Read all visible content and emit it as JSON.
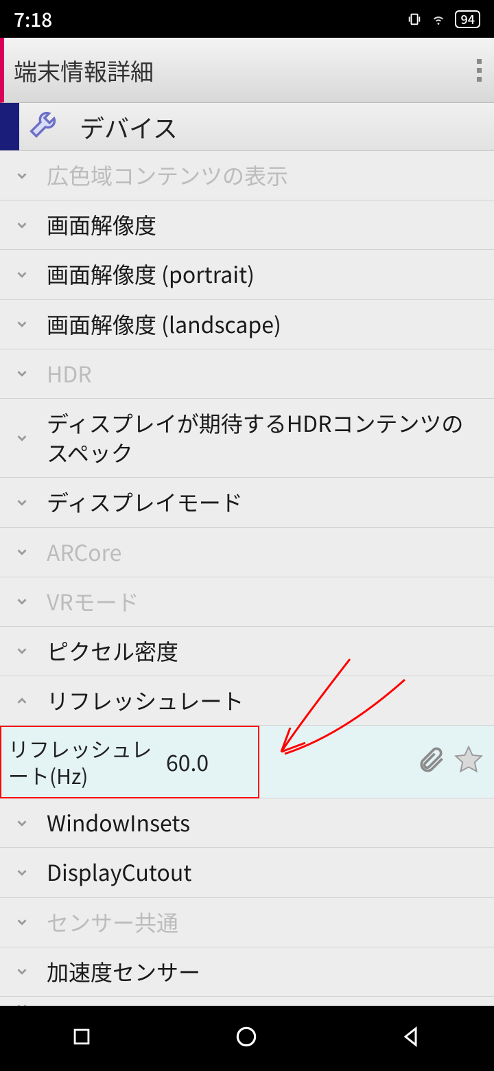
{
  "status": {
    "time": "7:18",
    "battery": "94"
  },
  "appbar": {
    "title": "端末情報詳細"
  },
  "section": {
    "title": "デバイス"
  },
  "rows": [
    {
      "label": "広色域コンテンツの表示",
      "muted": true,
      "expanded": false
    },
    {
      "label": "画面解像度",
      "muted": false,
      "expanded": false
    },
    {
      "label": "画面解像度 (portrait)",
      "muted": false,
      "expanded": false
    },
    {
      "label": "画面解像度 (landscape)",
      "muted": false,
      "expanded": false
    },
    {
      "label": "HDR",
      "muted": true,
      "expanded": false
    },
    {
      "label": "ディスプレイが期待するHDRコンテンツのスペック",
      "muted": false,
      "expanded": false
    },
    {
      "label": "ディスプレイモード",
      "muted": false,
      "expanded": false
    },
    {
      "label": "ARCore",
      "muted": true,
      "expanded": false
    },
    {
      "label": "VRモード",
      "muted": true,
      "expanded": false
    },
    {
      "label": "ピクセル密度",
      "muted": false,
      "expanded": false
    },
    {
      "label": "リフレッシュレート",
      "muted": false,
      "expanded": true
    }
  ],
  "detail": {
    "label": "リフレッシュレート(Hz)",
    "value": "60.0"
  },
  "rows2": [
    {
      "label": "WindowInsets",
      "muted": false
    },
    {
      "label": "DisplayCutout",
      "muted": false
    },
    {
      "label": "センサー共通",
      "muted": true
    },
    {
      "label": "加速度センサー",
      "muted": false
    }
  ]
}
